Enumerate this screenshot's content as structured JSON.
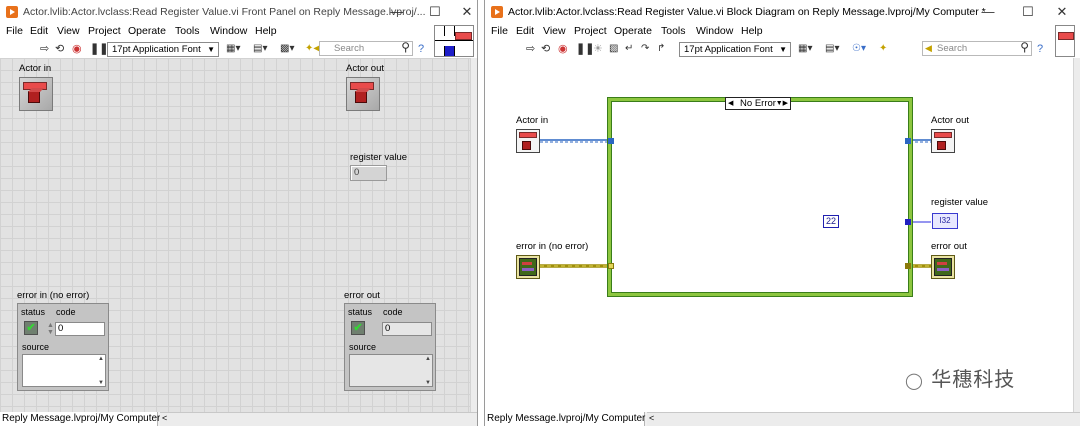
{
  "front_panel": {
    "title": "Actor.lvlib:Actor.lvclass:Read Register Value.vi Front Panel on Reply Message.lvproj/...",
    "menu": [
      "File",
      "Edit",
      "View",
      "Project",
      "Operate",
      "Tools",
      "Window",
      "Help"
    ],
    "font_select": "17pt Application Font",
    "search_placeholder": "Search",
    "controls": {
      "actor_in_label": "Actor in",
      "actor_out_label": "Actor out",
      "register_value_label": "register value",
      "register_value": "0",
      "error_in": {
        "label": "error in (no error)",
        "status_label": "status",
        "code_label": "code",
        "code_value": "0",
        "source_label": "source",
        "status_icon": "check-icon"
      },
      "error_out": {
        "label": "error out",
        "status_label": "status",
        "code_label": "code",
        "code_value": "0",
        "source_label": "source",
        "status_icon": "check-icon"
      }
    },
    "status_path": "Reply Message.lvproj/My Computer"
  },
  "block_diagram": {
    "title": "Actor.lvlib:Actor.lvclass:Read Register Value.vi Block Diagram on Reply Message.lvproj/My Computer *",
    "menu": [
      "File",
      "Edit",
      "View",
      "Project",
      "Operate",
      "Tools",
      "Window",
      "Help"
    ],
    "font_select": "17pt Application Font",
    "search_placeholder": "Search",
    "case_selector": "No Error",
    "constant_value": "22",
    "terminals": {
      "actor_in_label": "Actor in",
      "actor_out_label": "Actor out",
      "register_value_label": "register value",
      "register_value_type": "I32",
      "error_in_label": "error in (no error)",
      "error_out_label": "error out"
    },
    "status_path": "Reply Message.lvproj/My Computer",
    "watermark_text": "华穗科技"
  },
  "colors": {
    "object_wire": "#2b66c2",
    "error_wire": "#b8a70f",
    "numeric_wire": "#2b2be0",
    "case_border": "#8dc63f"
  }
}
